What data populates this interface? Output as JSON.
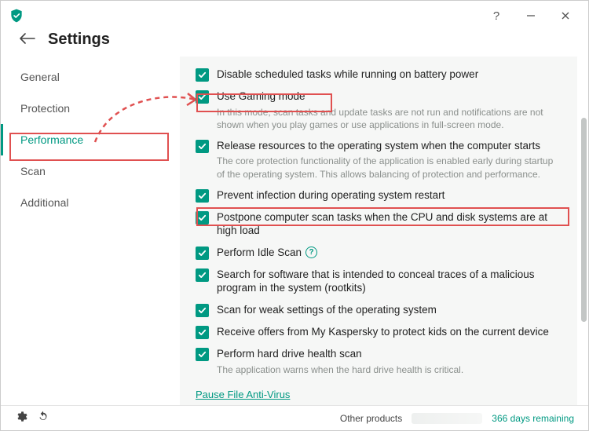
{
  "header": {
    "title": "Settings"
  },
  "sidebar": {
    "items": [
      {
        "label": "General"
      },
      {
        "label": "Protection"
      },
      {
        "label": "Performance"
      },
      {
        "label": "Scan"
      },
      {
        "label": "Additional"
      }
    ],
    "activeIndex": 2
  },
  "options": [
    {
      "label": "Disable scheduled tasks while running on battery power",
      "desc": "",
      "checked": true,
      "help": false
    },
    {
      "label": "Use Gaming mode",
      "desc": "In this mode, scan tasks and update tasks are not run and notifications are not shown when you play games or use applications in full-screen mode.",
      "checked": true,
      "help": false
    },
    {
      "label": "Release resources to the operating system when the computer starts",
      "desc": "The core protection functionality of the application is enabled early during startup of the operating system. This allows balancing of protection and performance.",
      "checked": true,
      "help": false
    },
    {
      "label": "Prevent infection during operating system restart",
      "desc": "",
      "checked": true,
      "help": false
    },
    {
      "label": "Postpone computer scan tasks when the CPU and disk systems are at high load",
      "desc": "",
      "checked": true,
      "help": false
    },
    {
      "label": "Perform Idle Scan",
      "desc": "",
      "checked": true,
      "help": true
    },
    {
      "label": "Search for software that is intended to conceal traces of a malicious program in the system (rootkits)",
      "desc": "",
      "checked": true,
      "help": false
    },
    {
      "label": "Scan for weak settings of the operating system",
      "desc": "",
      "checked": true,
      "help": false
    },
    {
      "label": "Receive offers from My Kaspersky to protect kids on the current device",
      "desc": "",
      "checked": true,
      "help": false
    },
    {
      "label": "Perform hard drive health scan",
      "desc": "The application warns when the hard drive health is critical.",
      "checked": true,
      "help": false
    }
  ],
  "pauseLink": "Pause File Anti-Virus",
  "footer": {
    "other": "Other products",
    "days": "366 days remaining"
  }
}
